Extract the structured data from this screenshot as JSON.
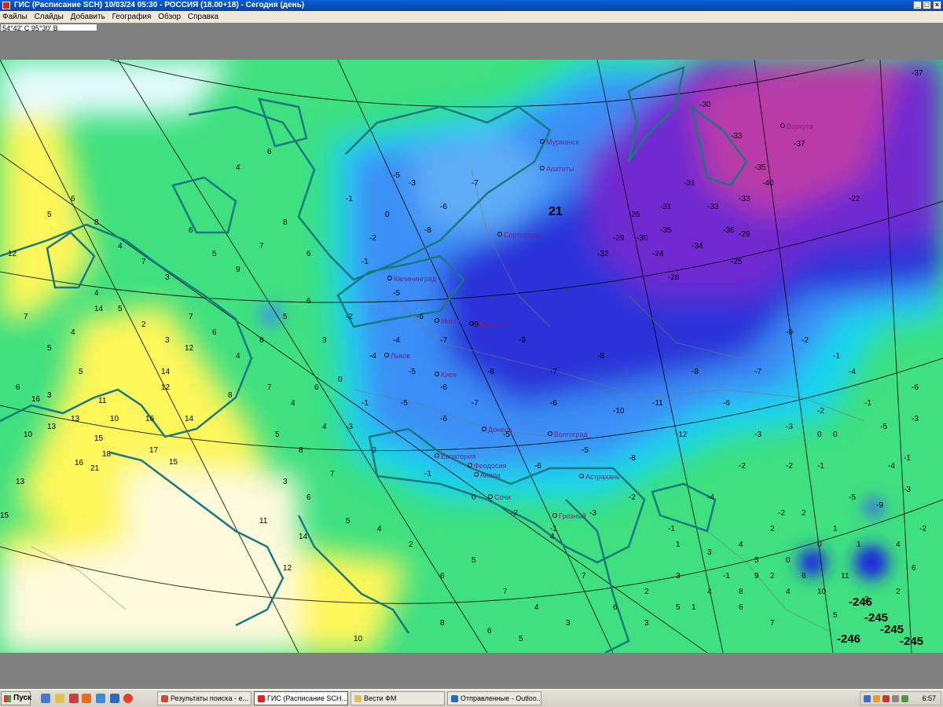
{
  "window": {
    "title": "ГИС (Расписание SCH) 10/03/24 05:30 - РОССИЯ (18.00+18) - Сегодня (день)",
    "buttons": {
      "minimize": "_",
      "maximize": "□",
      "close": "×"
    }
  },
  "menu": [
    "Файлы",
    "Слайды",
    "Добавить",
    "География",
    "Обзор",
    "Справка"
  ],
  "coordinates": "54°42' С 95°30' В",
  "map": {
    "cities": {
      "murmansk": "Мурманск",
      "apatity": "Апатиты",
      "sortavala": "Сортавала",
      "kaliningrad": "Калининград",
      "minsk": "Минск",
      "smolensk": "Смоленск",
      "kiev": "Киев",
      "lvov": "Львов",
      "donetsk": "Донецк",
      "volgograd": "Волгоград",
      "evpatoria": "Евпатория",
      "feodosia": "Феодосия",
      "anapa": "Анапа",
      "sochi": "Сочи",
      "astrakhan": "Астрахань",
      "grozny": "Грозный",
      "vorkuta": "Воркута"
    },
    "green_values": [
      "5",
      "6",
      "8",
      "4",
      "7",
      "3",
      "6",
      "5",
      "9",
      "7",
      "8",
      "6",
      "4",
      "5",
      "2",
      "3",
      "7",
      "6",
      "4",
      "8",
      "5",
      "6",
      "3",
      "7",
      "4",
      "6",
      "5",
      "8",
      "4",
      "3",
      "6",
      "7",
      "5",
      "4",
      "2",
      "6",
      "5",
      "7",
      "4",
      "3",
      "8",
      "6",
      "5",
      "4",
      "7",
      "6",
      "3",
      "5",
      "4",
      "6",
      "2",
      "7",
      "5",
      "4",
      "6",
      "3",
      "5",
      "8",
      "4",
      "6"
    ],
    "yellow_values": [
      "12",
      "14",
      "16",
      "13",
      "11",
      "15",
      "17",
      "10",
      "14",
      "12",
      "18",
      "16",
      "13",
      "21",
      "15",
      "12",
      "10",
      "16",
      "14",
      "13",
      "15",
      "11",
      "14",
      "12",
      "10"
    ],
    "cyan_values": [
      "-1",
      "-2",
      "0",
      "-3",
      "-1",
      "-2",
      "-4",
      "0",
      "-1",
      "-3",
      "-2",
      "-1",
      "0",
      "-2",
      "-1",
      "-3",
      "-2",
      "-1",
      "-4",
      "-2"
    ],
    "blue_values": [
      "-5",
      "-6",
      "-7",
      "-8",
      "-5",
      "-6",
      "-4",
      "-7",
      "-9",
      "-5",
      "-6",
      "-8",
      "-7",
      "-5",
      "-6",
      "-9",
      "-7",
      "-8",
      "-6",
      "-5",
      "-10",
      "-11",
      "-8",
      "-6",
      "-7",
      "-9",
      "-12",
      "-5",
      "-6",
      "-8"
    ],
    "purple_values": [
      "-30",
      "-33",
      "-35",
      "-37",
      "-26",
      "-31",
      "-29",
      "-32",
      "-24",
      "-36",
      "-34",
      "-28",
      "-25",
      "-31",
      "-33",
      "-30",
      "-35",
      "-29",
      "-22",
      "-37",
      "-40",
      "-33"
    ],
    "large_values": [
      "21",
      "-246",
      "-245",
      "-246",
      "-245",
      "-245"
    ],
    "east_values": [
      "-3",
      "-2",
      "-4",
      "-1",
      "0",
      "-5",
      "-3",
      "-2",
      "-1",
      "-6",
      "-4",
      "-2",
      "-3",
      "-1",
      "-9",
      "-5",
      "-3",
      "-2",
      "1",
      "2",
      "0",
      "-1"
    ],
    "south_values": [
      "1",
      "3",
      "4",
      "2",
      "0",
      "-1",
      "5",
      "3",
      "2",
      "1",
      "4",
      "6",
      "7",
      "9",
      "8",
      "10",
      "11",
      "5",
      "3",
      "2",
      "6",
      "4",
      "1",
      "0",
      "-2"
    ]
  },
  "taskbar": {
    "start": "Пуск",
    "tasks": [
      "Результаты поиска - е...",
      "ГИС (Расписание SCH...",
      "Вести ФМ",
      "Отправленные - Outloo..."
    ],
    "clock": "6:57"
  }
}
